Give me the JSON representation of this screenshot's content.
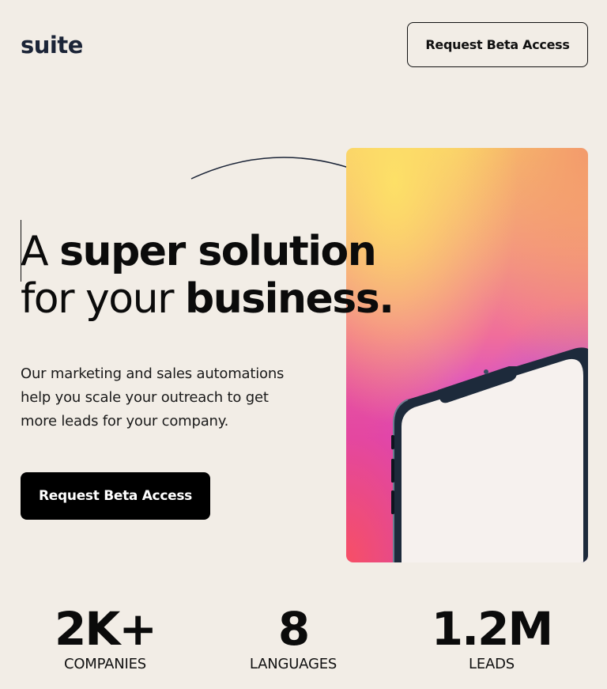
{
  "header": {
    "logo_text": "suite",
    "cta_label": "Request Beta Access"
  },
  "hero": {
    "headline_line1_light": "A ",
    "headline_line1_bold": "super solution",
    "headline_line2_light": "for your ",
    "headline_line2_bold": "business.",
    "subtext": "Our marketing and sales automations help you scale your outreach to get more leads for your company.",
    "cta_label": "Request Beta Access",
    "image_icon": "phone-chart-illustration"
  },
  "stats": [
    {
      "value": "2K+",
      "label": "COMPANIES"
    },
    {
      "value": "8",
      "label": "LANGUAGES"
    },
    {
      "value": "1.2M",
      "label": "LEADS"
    }
  ],
  "colors": {
    "background": "#f2ede6",
    "primary_button": "#000000",
    "logo": "#1b2437",
    "gradient_top": "#fde067",
    "gradient_mid": "#f06e9a",
    "gradient_bottom": "#c63fcf",
    "bars": "#ec4fa9"
  }
}
